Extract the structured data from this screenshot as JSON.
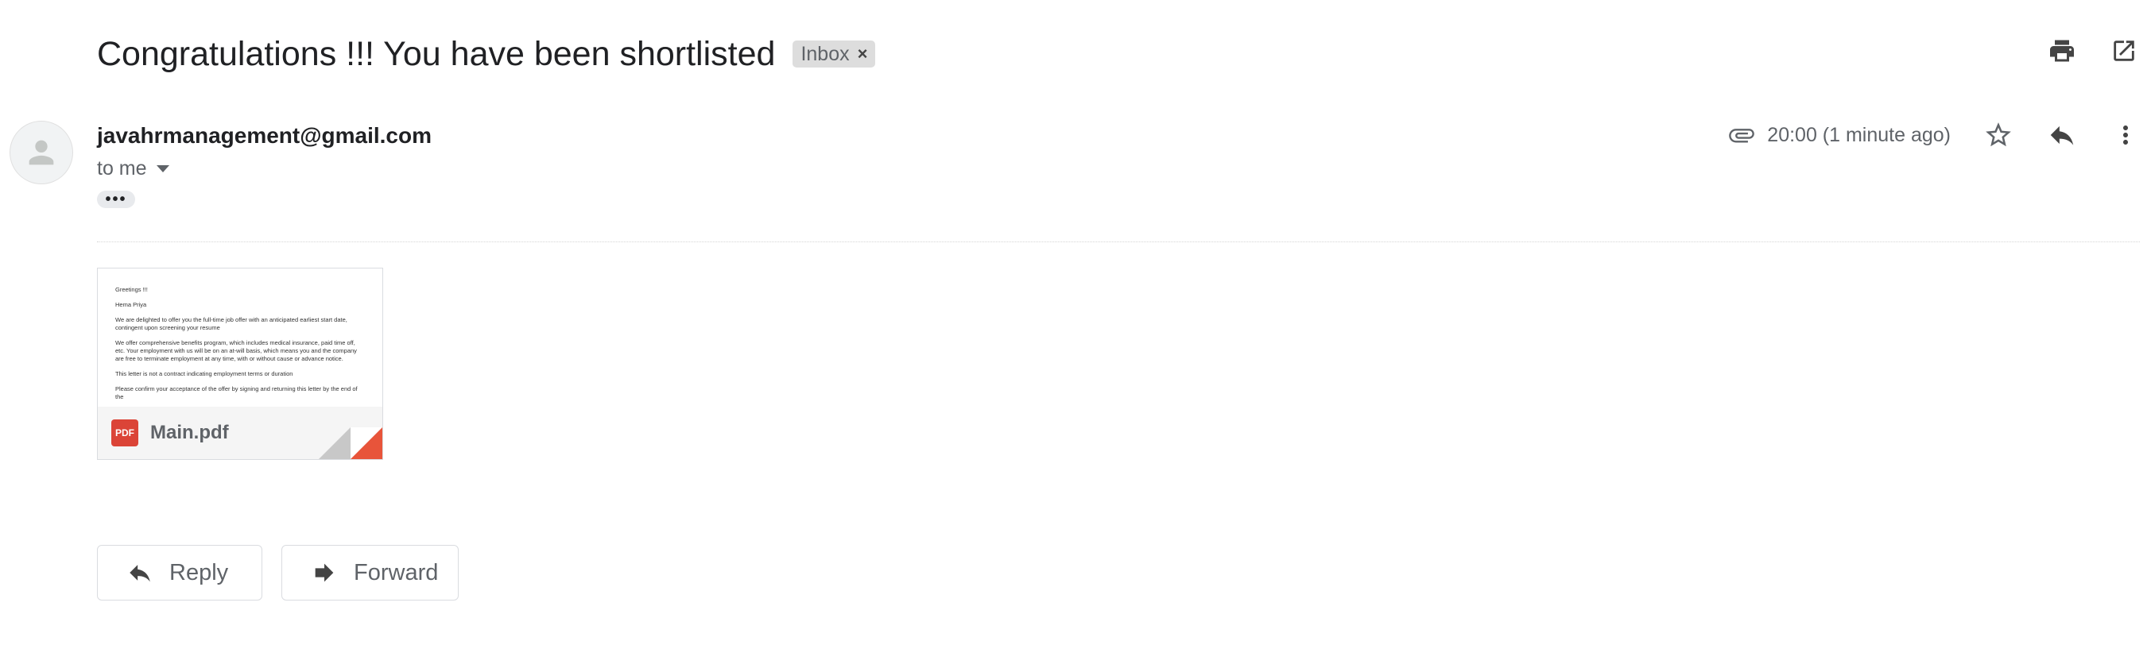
{
  "header": {
    "subject": "Congratulations !!! You have been shortlisted",
    "label": "Inbox",
    "label_remove": "×"
  },
  "message": {
    "sender": "javahrmanagement@gmail.com",
    "recipient": "to me",
    "time": "20:00 (1 minute ago)",
    "ellipsis": "•••"
  },
  "attachment": {
    "filename": "Main.pdf",
    "type_badge": "PDF",
    "preview_lines": [
      "Greetings !!!",
      "Hema Priya",
      "We are delighted to offer you the full-time job offer with an anticipated earliest start date, contingent upon screening your resume",
      "We offer comprehensive benefits program, which includes medical insurance, paid time off, etc. Your employment with us will be on an at-will basis, which means you and the company are free to terminate employment at any time, with or without cause or advance notice.",
      "This letter is not a contract indicating employment terms or duration",
      "Please confirm your acceptance of the offer by signing and returning this letter by the end of the"
    ]
  },
  "actions": {
    "reply_label": "Reply",
    "forward_label": "Forward"
  },
  "icons": {
    "print": "printer-icon",
    "open_new_window": "open-in-new-icon",
    "attachment": "paperclip-icon",
    "star": "star-icon",
    "reply": "reply-icon",
    "more": "more-vert-icon",
    "forward": "forward-icon"
  },
  "colors": {
    "pdf_red": "#db4437",
    "fold_orange": "#e8543a",
    "chip_bg": "#dddddd"
  }
}
